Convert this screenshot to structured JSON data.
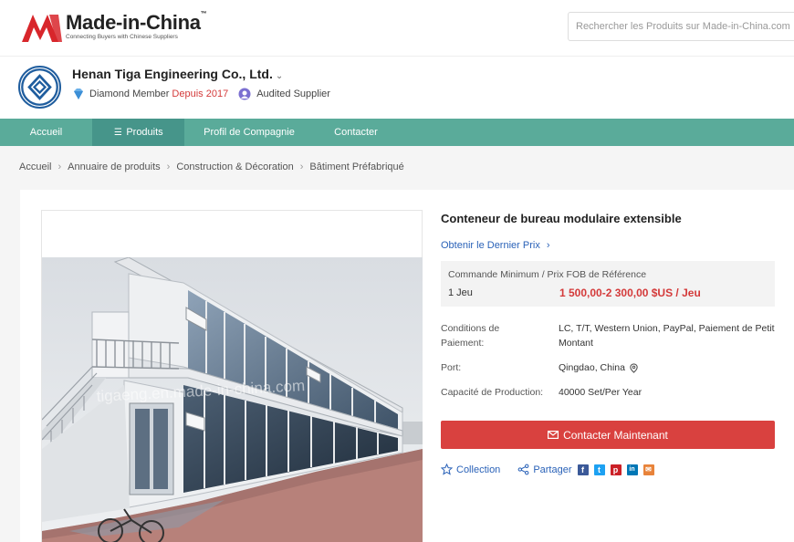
{
  "header": {
    "logo_title": "Made-in-China",
    "logo_tm": "™",
    "logo_tagline": "Connecting Buyers with Chinese Suppliers",
    "search_placeholder": "Rechercher les Produits sur Made-in-China.com"
  },
  "company": {
    "name": "Henan Tiga Engineering Co., Ltd.",
    "name_chevron": "⌄",
    "member": "Diamond Member",
    "since": "Depuis 2017",
    "audited": "Audited Supplier"
  },
  "nav": {
    "items": [
      {
        "label": "Accueil"
      },
      {
        "label": "Produits",
        "icon": "☰"
      },
      {
        "label": "Profil de Compagnie"
      },
      {
        "label": "Contacter"
      }
    ]
  },
  "breadcrumb": {
    "items": [
      "Accueil",
      "Annuaire de produits",
      "Construction & Décoration",
      "Bâtiment Préfabriqué"
    ],
    "separator": "›"
  },
  "product": {
    "title": "Conteneur de bureau modulaire extensible",
    "price_link": "Obtenir le Dernier Prix",
    "price_link_chevron": "›",
    "price_header": "Commande Minimum / Prix FOB de Référence",
    "min_qty": "1 Jeu",
    "price": "1 500,00-2 300,00 $US  / Jeu",
    "rows": [
      {
        "label": "Conditions de Paiement:",
        "value": "LC, T/T, Western Union, PayPal, Paiement de Petit Montant"
      },
      {
        "label": "Port:",
        "value": "Qingdao, China"
      },
      {
        "label": "Capacité de Production:",
        "value": "40000 Set/Per Year"
      }
    ],
    "watermark": "tigaeng.en.made-in-china.com"
  },
  "actions": {
    "contact": "Contacter Maintenant",
    "collection": "Collection",
    "share": "Partager",
    "share_icons": [
      {
        "name": "facebook-icon",
        "glyph": "f",
        "color": "#3b5998"
      },
      {
        "name": "twitter-icon",
        "glyph": "t",
        "color": "#1da1f2"
      },
      {
        "name": "pinterest-icon",
        "glyph": "p",
        "color": "#cb2027"
      },
      {
        "name": "linkedin-icon",
        "glyph": "in",
        "color": "#0077b5"
      },
      {
        "name": "email-share-icon",
        "glyph": "✉",
        "color": "#e8833a"
      }
    ]
  },
  "colors": {
    "nav": "#5aab9a",
    "accent_red": "#d9413f",
    "link": "#2a62b8"
  }
}
